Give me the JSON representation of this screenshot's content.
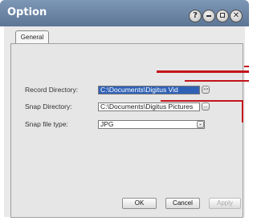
{
  "window": {
    "title": "Option"
  },
  "titlebar_buttons": {
    "help": "?",
    "minimize": "minimize-icon",
    "maximize": "maximize-icon",
    "close": "✕"
  },
  "tabs": [
    {
      "label": "General"
    }
  ],
  "form": {
    "record_directory": {
      "label": "Record Directory:",
      "value": "C:\\Documents\\Digitus Vid",
      "browse": ">>"
    },
    "snap_directory": {
      "label": "Snap Directory:",
      "value": "C:\\Documents\\Digitus Pictures",
      "browse": "..."
    },
    "snap_file_type": {
      "label": "Snap file type:",
      "value": "JPG",
      "arrow": "⌄"
    }
  },
  "buttons": {
    "ok": "OK",
    "cancel": "Cancel",
    "apply": "Apply"
  },
  "colors": {
    "titlebar": "#6b84a4",
    "selection": "#2f61b6",
    "annotation": "#c3141b"
  }
}
